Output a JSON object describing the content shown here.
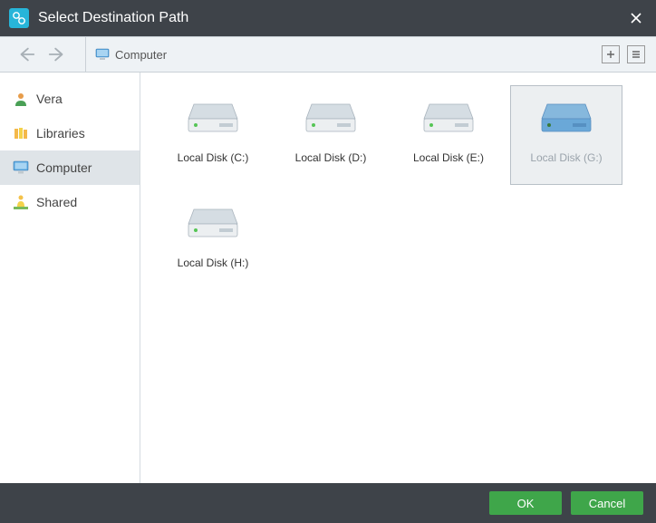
{
  "window": {
    "title": "Select Destination Path"
  },
  "breadcrumb": {
    "location": "Computer"
  },
  "sidebar": {
    "items": [
      {
        "label": "Vera",
        "kind": "user"
      },
      {
        "label": "Libraries",
        "kind": "libraries"
      },
      {
        "label": "Computer",
        "kind": "computer",
        "selected": true
      },
      {
        "label": "Shared",
        "kind": "shared"
      }
    ]
  },
  "disks": [
    {
      "label": "Local Disk (C:)",
      "selected": false
    },
    {
      "label": "Local Disk (D:)",
      "selected": false
    },
    {
      "label": "Local Disk (E:)",
      "selected": false
    },
    {
      "label": "Local Disk (G:)",
      "selected": true
    },
    {
      "label": "Local Disk (H:)",
      "selected": false
    }
  ],
  "footer": {
    "ok": "OK",
    "cancel": "Cancel"
  },
  "colors": {
    "accent": "#3fa64a",
    "titlebar": "#3e4349",
    "selected_disk_body": "#6aa8d8"
  }
}
